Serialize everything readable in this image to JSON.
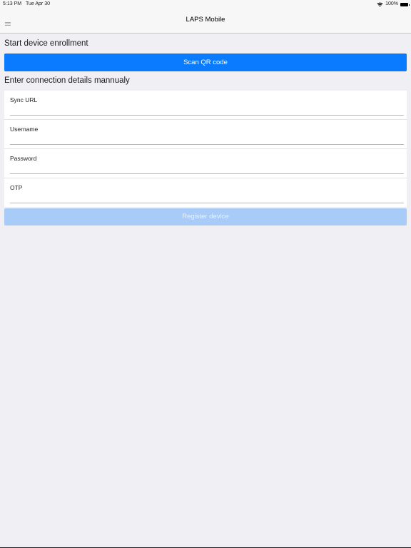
{
  "status_bar": {
    "time": "5:13 PM",
    "date": "Tue Apr 30",
    "battery": "100%"
  },
  "nav": {
    "title": "LAPS Mobile"
  },
  "enrollment": {
    "title": "Start device enrollment",
    "scan_label": "Scan QR code"
  },
  "manual": {
    "title": "Enter connection details mannualy",
    "fields": [
      {
        "label": "Sync URL",
        "value": ""
      },
      {
        "label": "Username",
        "value": ""
      },
      {
        "label": "Password",
        "value": ""
      },
      {
        "label": "OTP",
        "value": ""
      }
    ],
    "register_label": "Register device"
  },
  "colors": {
    "accent": "#0a7aff",
    "accent_disabled": "#a8cbf7",
    "background": "#efeff4"
  },
  "icons": {
    "menu": "hamburger-menu-icon",
    "wifi": "wifi-icon",
    "battery": "battery-icon"
  }
}
